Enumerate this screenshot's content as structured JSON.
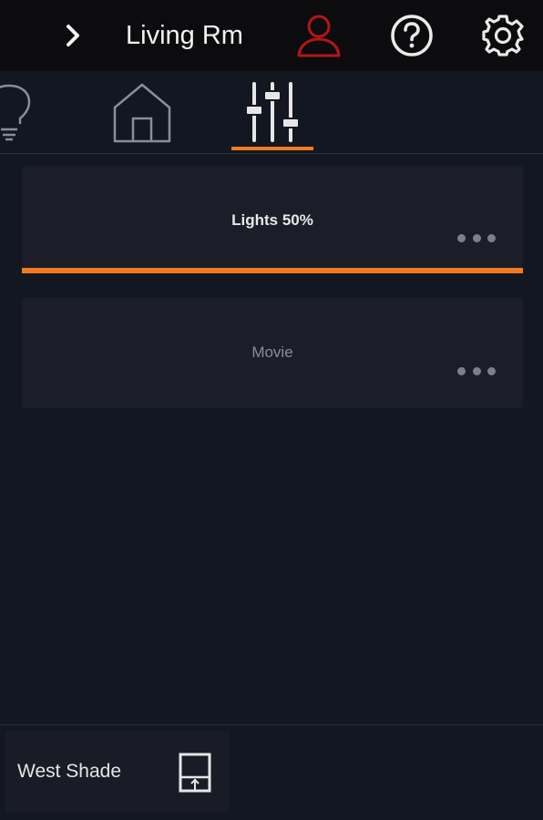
{
  "header": {
    "room_title": "Living Rm",
    "icons": {
      "back": "chevron-right-icon",
      "user": "user-icon",
      "help": "help-icon",
      "settings": "gear-icon"
    }
  },
  "tabs": [
    {
      "id": "lights",
      "icon": "light-bulb-icon",
      "selected": false
    },
    {
      "id": "rooms",
      "icon": "house-icon",
      "selected": false
    },
    {
      "id": "scenes",
      "icon": "sliders-icon",
      "selected": true
    }
  ],
  "scenes": [
    {
      "label": "Lights 50%",
      "active": true,
      "menu_icon": "more-dots-icon"
    },
    {
      "label": "Movie",
      "active": false,
      "menu_icon": "more-dots-icon"
    }
  ],
  "quick_controls": [
    {
      "label": "West Shade",
      "icon": "shade-icon"
    }
  ],
  "colors": {
    "accent": "#f47a1f",
    "background": "#131722",
    "header_bg": "#0c0c0e",
    "card_bg": "#1b1e29",
    "user_icon": "#b51515",
    "icon_light": "#e6e6e6",
    "icon_muted": "#8b8e96"
  }
}
